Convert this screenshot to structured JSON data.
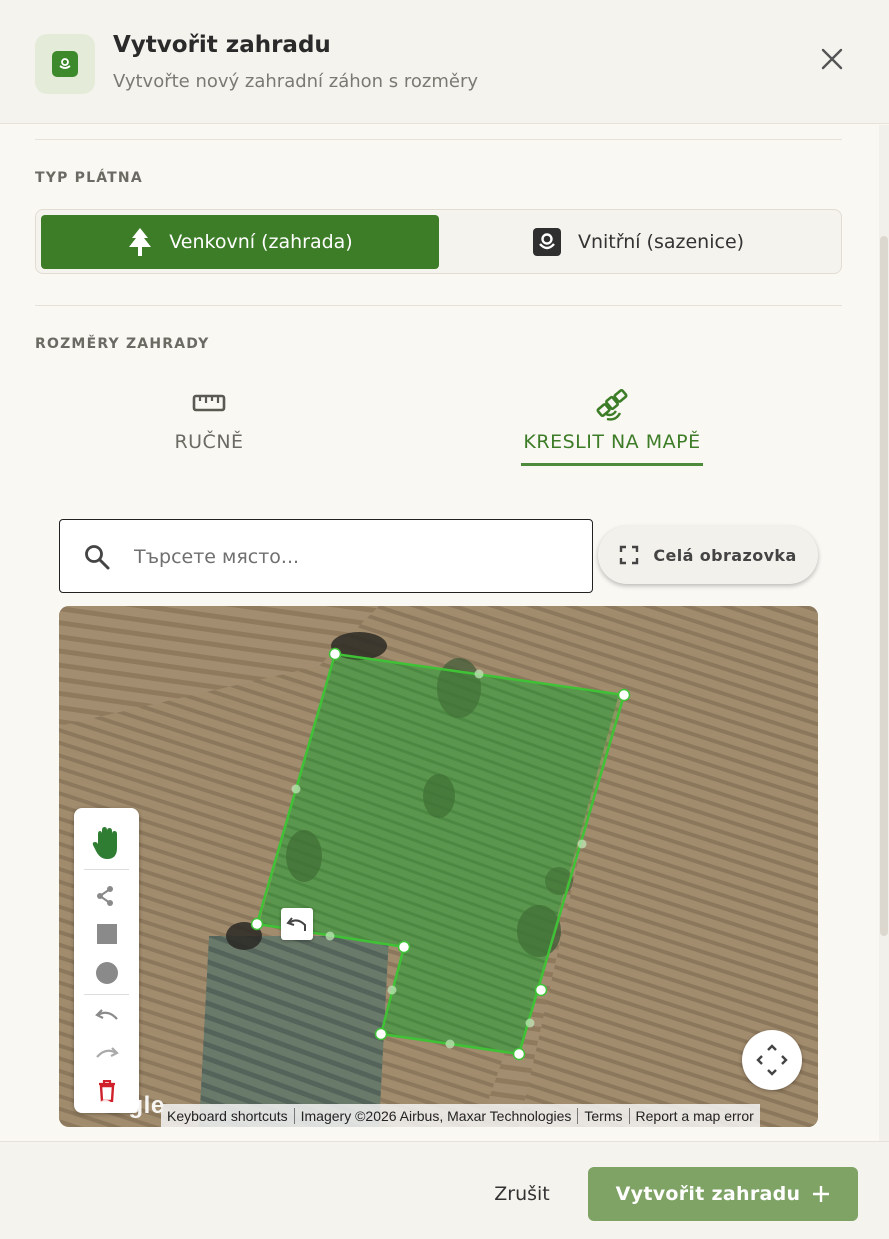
{
  "header": {
    "title": "Vytvořit zahradu",
    "subtitle": "Vytvořte nový zahradní záhon s rozměry"
  },
  "canvas_type": {
    "label": "TYP PLÁTNA",
    "options": [
      {
        "label": "Venkovní (zahrada)",
        "icon": "tree-icon",
        "selected": true
      },
      {
        "label": "Vnitřní (sazenice)",
        "icon": "seedling-icon",
        "selected": false
      }
    ]
  },
  "dimensions": {
    "label": "ROZMĚRY ZAHRADY",
    "tabs": [
      {
        "label": "RUČNĚ",
        "icon": "ruler-icon",
        "active": false
      },
      {
        "label": "KRESLIT NA MAPĚ",
        "icon": "satellite-icon",
        "active": true
      }
    ]
  },
  "search": {
    "placeholder": "Търсете място...",
    "value": ""
  },
  "fullscreen": {
    "label": "Celá obrazovka"
  },
  "map": {
    "logo": "Google",
    "attribution": [
      "Keyboard shortcuts",
      "Imagery ©2026 Airbus, Maxar Technologies",
      "Terms",
      "Report a map error"
    ],
    "tools": [
      "hand-icon",
      "polyline-icon",
      "rectangle-icon",
      "circle-icon",
      "undo-icon",
      "redo-icon",
      "trash-icon"
    ]
  },
  "footer": {
    "cancel_label": "Zrušit",
    "create_label": "Vytvořit zahradu"
  },
  "colors": {
    "accent": "#3d7d28",
    "button": "#7ea365",
    "delete": "#d0202a"
  }
}
